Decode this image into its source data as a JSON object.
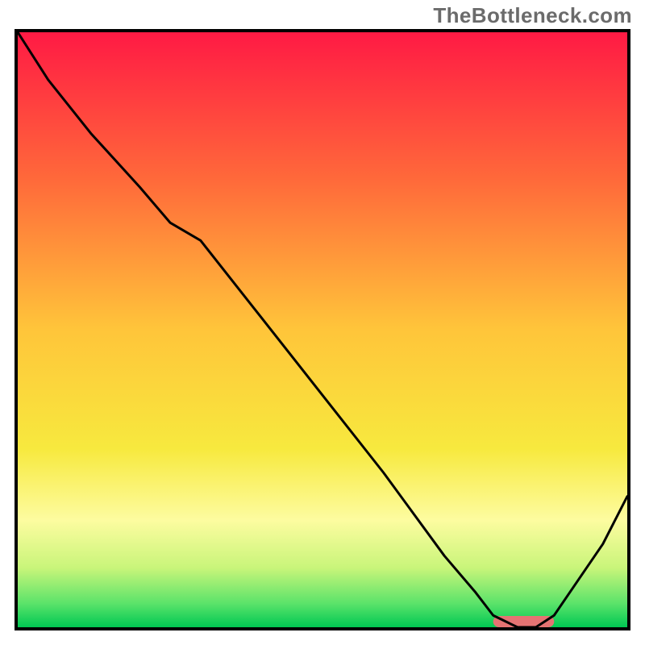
{
  "watermark": {
    "text": "TheBottleneck.com"
  },
  "chart_data": {
    "type": "line",
    "title": "",
    "xlabel": "",
    "ylabel": "",
    "xlim": [
      0,
      100
    ],
    "ylim": [
      0,
      100
    ],
    "grid": false,
    "legend": false,
    "background": {
      "comment": "Vertical gradient backdrop, red→orange→yellow→pale-yellow→green",
      "stops": [
        {
          "pos": 0.0,
          "color": "#ff1a44"
        },
        {
          "pos": 0.25,
          "color": "#ff6a3a"
        },
        {
          "pos": 0.5,
          "color": "#ffc53a"
        },
        {
          "pos": 0.7,
          "color": "#f7e93e"
        },
        {
          "pos": 0.82,
          "color": "#fdfca0"
        },
        {
          "pos": 0.9,
          "color": "#c9f57a"
        },
        {
          "pos": 0.96,
          "color": "#5be36a"
        },
        {
          "pos": 1.0,
          "color": "#00c853"
        }
      ]
    },
    "series": [
      {
        "name": "main-curve",
        "color": "#000000",
        "stroke_width": 3,
        "comment": "y is bottleneck-like metric; high at left, dips to ~0 near x≈82, rises again. Estimated from pixel positions.",
        "x": [
          0,
          5,
          12,
          20,
          25,
          30,
          40,
          50,
          60,
          70,
          75,
          78,
          80,
          82,
          85,
          88,
          92,
          96,
          100
        ],
        "y": [
          100,
          92,
          83,
          74,
          68,
          65,
          52,
          39,
          26,
          12,
          6,
          2,
          1,
          0,
          0,
          2,
          8,
          14,
          22
        ]
      }
    ],
    "marker": {
      "comment": "Short salmon bar marking the zero/optimal region along x-axis",
      "color": "#e57373",
      "x_start": 78,
      "x_end": 88,
      "y": 0,
      "thickness_px": 14
    }
  }
}
